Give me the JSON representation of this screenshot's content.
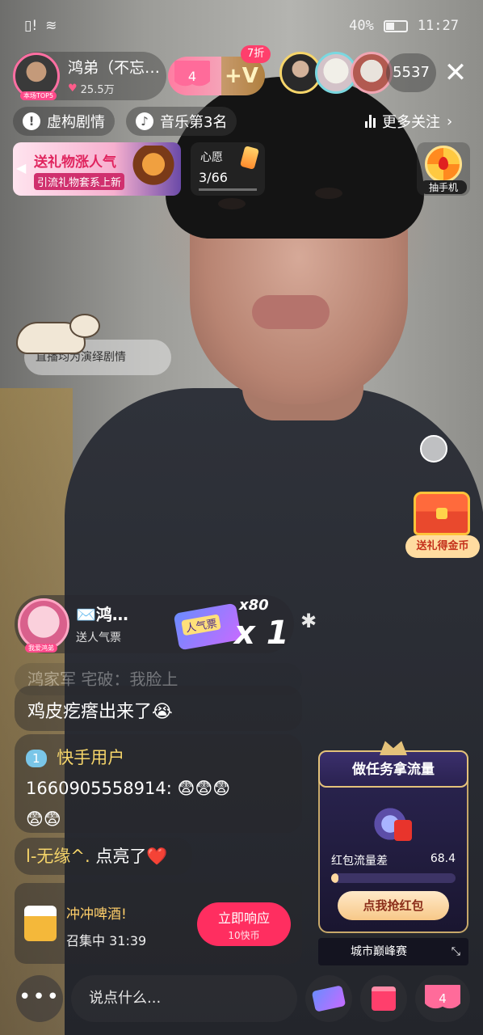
{
  "status_bar": {
    "battery": "40%",
    "time": "11:27"
  },
  "anchor": {
    "name": "鸿弟（不忘…",
    "likes": "25.5万",
    "avatar_tag": "本场TOP5"
  },
  "fan_group": {
    "heart_count": "4",
    "v_label": "+V",
    "discount": "7折"
  },
  "viewers": {
    "count": "5537"
  },
  "chips": {
    "plot": "虚构剧情",
    "music": "音乐第3名",
    "more_follow": "更多关注"
  },
  "gift_banner": {
    "title": "送礼物涨人气",
    "subtitle": "引流礼物套系上新"
  },
  "wish": {
    "title": "心愿",
    "progress_text": "3/66",
    "progress_fraction": 0.045
  },
  "lottery": {
    "label": "抽手机"
  },
  "caption": {
    "text": "直播均为演绎剧情"
  },
  "treasure": {
    "label": "送礼得金币"
  },
  "gift_event": {
    "sender": "✉️鸿…",
    "action": "送人气票",
    "avatar_tag": "我爱鸿弟",
    "card_label": "人气票",
    "combo_total": "x80",
    "combo_now": "x 1"
  },
  "chat": {
    "faded": "鸿家军 宅破：我脸上",
    "msg1": "鸡皮疙瘩出来了😭",
    "msg2_level": "1",
    "msg2_user": "快手用户",
    "msg2_line2": "1660905558914: 😨😨😨",
    "msg2_line3": "😨😨",
    "msg3_user": "l-无缘^.",
    "msg3_text": "点亮了❤️",
    "promo_title": "冲冲啤酒!",
    "promo_sub": "召集中 31:39",
    "promo_btn": "立即响应",
    "promo_btn_sub": "10快币"
  },
  "task": {
    "title": "做任务拿流量",
    "label": "红包流量差",
    "value": "68.4",
    "progress_fraction": 0.06,
    "grab_btn": "点我抢红包",
    "city": "城市巅峰赛"
  },
  "bottom_bar": {
    "more": "•••",
    "input_placeholder": "说点什么...",
    "like_count": "4"
  },
  "colors": {
    "accent_pink": "#ff3f6c",
    "gold": "#f6d56a"
  }
}
